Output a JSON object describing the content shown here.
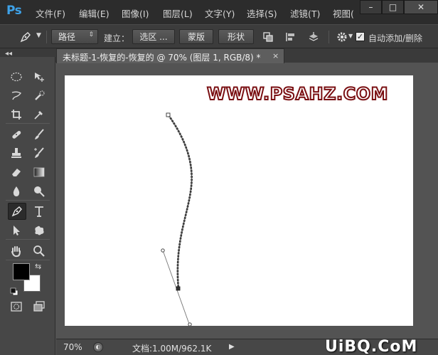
{
  "app": {
    "logo": "Ps"
  },
  "menu": [
    "文件(F)",
    "编辑(E)",
    "图像(I)",
    "图层(L)",
    "文字(Y)",
    "选择(S)",
    "滤镜(T)",
    "视图("
  ],
  "window_controls": {
    "minimize": "–",
    "restore": "□",
    "close": "✕"
  },
  "options_bar": {
    "mode_select": "路径",
    "make_label": "建立：",
    "selection_button": "选区 ...",
    "mask_button": "蒙版",
    "shape_button": "形状",
    "auto_add_delete_label": "自动添加/删除",
    "auto_add_delete_checked": true
  },
  "document_tab": {
    "title": "未标题-1-恢复的-恢复的 @ 70% (图层 1, RGB/8) *",
    "close": "×"
  },
  "canvas": {
    "watermark_text": "WWW.PSAHZ.COM",
    "watermark_color": "#7a0f12"
  },
  "status_bar": {
    "zoom": "70%",
    "doc_size": "文档:1.00M/962.1K",
    "arrow": "▶"
  },
  "footer_watermark": "UiBQ.CoM",
  "colors": {
    "foreground": "#000000",
    "background": "#ffffff"
  },
  "tools": [
    "marquee-icon",
    "move-icon",
    "lasso-icon",
    "quick-selection-icon",
    "crop-icon",
    "eyedropper-icon",
    "spot-healing-icon",
    "brush-icon",
    "clone-stamp-icon",
    "history-brush-icon",
    "eraser-icon",
    "gradient-icon",
    "blur-icon",
    "dodge-icon",
    "pen-icon",
    "type-icon",
    "path-selection-icon",
    "custom-shape-icon",
    "hand-icon",
    "zoom-icon",
    "quick-mask-icon",
    "screen-mode-icon"
  ]
}
